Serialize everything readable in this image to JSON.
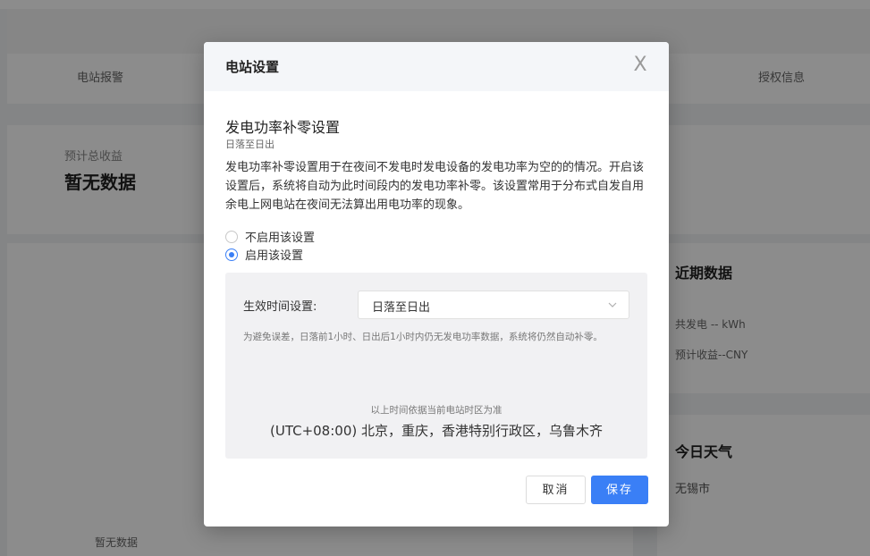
{
  "background": {
    "nav": [
      "电站报警",
      "授权信息"
    ],
    "revenue_label": "预计总收益",
    "revenue_value": "暂无数据",
    "recent_title": "近期数据",
    "recent_generation": "共发电 -- kWh",
    "recent_income": "预计收益--CNY",
    "weather_title": "今日天气",
    "weather_city": "无锡市",
    "bottom_empty": "暂无数据"
  },
  "modal": {
    "title": "电站设置",
    "close_glyph": "X",
    "section_title": "发电功率补零设置",
    "section_subtitle": "日落至日出",
    "description": "发电功率补零设置用于在夜间不发电时发电设备的发电功率为空的的情况。开启该设置后，系统将自动为此时间段内的发电功率补零。该设置常用于分布式自发自用余电上网电站在夜间无法算出用电功率的现象。",
    "radio_options": [
      {
        "label": "不启用该设置",
        "checked": false
      },
      {
        "label": "启用该设置",
        "checked": true
      }
    ],
    "panel": {
      "field_label": "生效时间设置:",
      "select_value": "日落至日出",
      "tip": "为避免误差，日落前1小时、日出后1小时内仍无发电功率数据，系统将仍然自动补零。",
      "tz_note": "以上时间依据当前电站时区为准",
      "tz_value": "(UTC+08:00) 北京，重庆，香港特别行政区，乌鲁木齐"
    },
    "cancel_label": "取消",
    "save_label": "保存"
  },
  "colors": {
    "accent": "#3a7ff6",
    "mask": "rgba(0,0,0,0.45)"
  }
}
